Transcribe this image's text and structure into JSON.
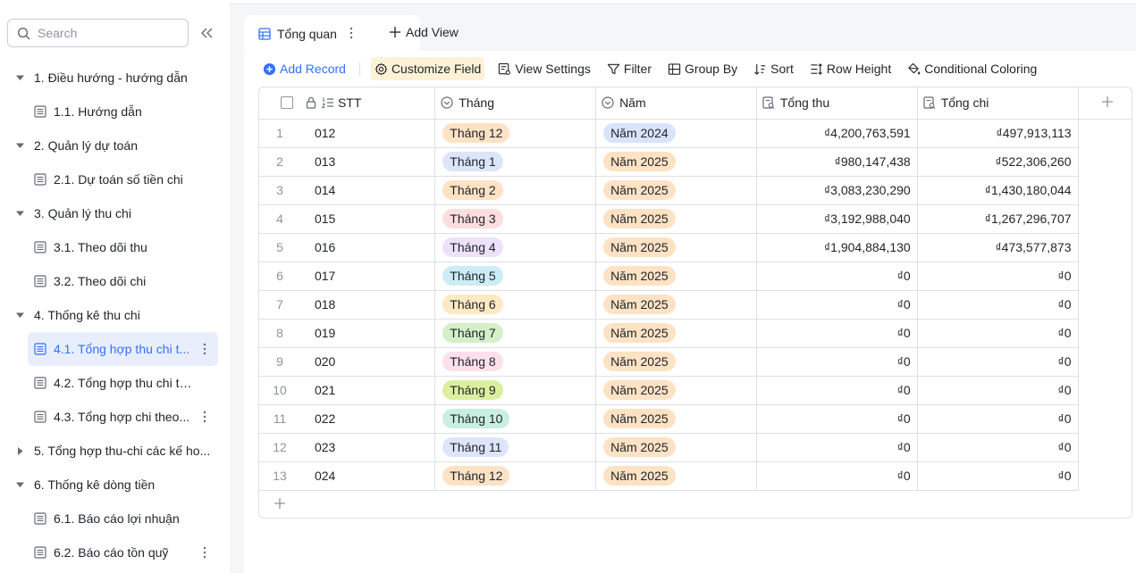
{
  "sidebar": {
    "search_placeholder": "Search",
    "items": [
      {
        "type": "group",
        "label": "1. Điều hướng - hướng dẫn",
        "expanded": true
      },
      {
        "type": "leaf",
        "label": "1.1. Hướng dẫn"
      },
      {
        "type": "group",
        "label": "2. Quản lý dự toán",
        "expanded": true
      },
      {
        "type": "leaf",
        "label": "2.1. Dự toán số tiền chi"
      },
      {
        "type": "group",
        "label": "3. Quản lý thu chi",
        "expanded": true
      },
      {
        "type": "leaf",
        "label": "3.1. Theo dõi thu"
      },
      {
        "type": "leaf",
        "label": "3.2. Theo dõi chi"
      },
      {
        "type": "group",
        "label": "4. Thống kê thu chi",
        "expanded": true
      },
      {
        "type": "leaf",
        "label": "4.1. Tổng hợp thu chi t...",
        "active": true,
        "more": true
      },
      {
        "type": "leaf",
        "label": "4.2. Tổng hợp thu chi theo..."
      },
      {
        "type": "leaf",
        "label": "4.3. Tổng hợp chi theo...",
        "more": true
      },
      {
        "type": "group",
        "label": "5. Tổng hợp thu-chi các kế ho...",
        "expanded": false
      },
      {
        "type": "group",
        "label": "6. Thống kê dòng tiền",
        "expanded": true
      },
      {
        "type": "leaf",
        "label": "6.1. Báo cáo lợi nhuận"
      },
      {
        "type": "leaf",
        "label": "6.2. Báo cáo tồn quỹ",
        "more": true
      }
    ]
  },
  "tabs": {
    "active_label": "Tổng quan",
    "add_view_label": "Add View"
  },
  "toolbar": {
    "add_record": "Add Record",
    "customize_field": "Customize Field",
    "view_settings": "View Settings",
    "filter": "Filter",
    "group_by": "Group By",
    "sort": "Sort",
    "row_height": "Row Height",
    "conditional_coloring": "Conditional Coloring"
  },
  "table": {
    "columns": [
      "STT",
      "Tháng",
      "Năm",
      "Tổng thu",
      "Tổng chi"
    ],
    "rows": [
      {
        "n": "1",
        "stt": "012",
        "thang": "Tháng 12",
        "thang_color": "#fde2c4",
        "nam": "Năm 2024",
        "nam_color": "#d9e4fb",
        "thu": "₫4,200,763,591",
        "chi": "₫497,913,113"
      },
      {
        "n": "2",
        "stt": "013",
        "thang": "Tháng 1",
        "thang_color": "#dde5fb",
        "nam": "Năm 2025",
        "nam_color": "#fde2c4",
        "thu": "₫980,147,438",
        "chi": "₫522,306,260"
      },
      {
        "n": "3",
        "stt": "014",
        "thang": "Tháng 2",
        "thang_color": "#fde2c4",
        "nam": "Năm 2025",
        "nam_color": "#fde2c4",
        "thu": "₫3,083,230,290",
        "chi": "₫1,430,180,044"
      },
      {
        "n": "4",
        "stt": "015",
        "thang": "Tháng 3",
        "thang_color": "#fddede",
        "nam": "Năm 2025",
        "nam_color": "#fde2c4",
        "thu": "₫3,192,988,040",
        "chi": "₫1,267,296,707"
      },
      {
        "n": "5",
        "stt": "016",
        "thang": "Tháng 4",
        "thang_color": "#ece2fa",
        "nam": "Năm 2025",
        "nam_color": "#fde2c4",
        "thu": "₫1,904,884,130",
        "chi": "₫473,577,873"
      },
      {
        "n": "6",
        "stt": "017",
        "thang": "Tháng 5",
        "thang_color": "#ccecf6",
        "nam": "Năm 2025",
        "nam_color": "#fde2c4",
        "thu": "₫0",
        "chi": "₫0"
      },
      {
        "n": "7",
        "stt": "018",
        "thang": "Tháng 6",
        "thang_color": "#fde9c4",
        "nam": "Năm 2025",
        "nam_color": "#fde2c4",
        "thu": "₫0",
        "chi": "₫0"
      },
      {
        "n": "8",
        "stt": "019",
        "thang": "Tháng 7",
        "thang_color": "#d3f0c8",
        "nam": "Năm 2025",
        "nam_color": "#fde2c4",
        "thu": "₫0",
        "chi": "₫0"
      },
      {
        "n": "9",
        "stt": "020",
        "thang": "Tháng 8",
        "thang_color": "#fde0ea",
        "nam": "Năm 2025",
        "nam_color": "#fde2c4",
        "thu": "₫0",
        "chi": "₫0"
      },
      {
        "n": "10",
        "stt": "021",
        "thang": "Tháng 9",
        "thang_color": "#dcef9f",
        "nam": "Năm 2025",
        "nam_color": "#fde2c4",
        "thu": "₫0",
        "chi": "₫0"
      },
      {
        "n": "11",
        "stt": "022",
        "thang": "Tháng 10",
        "thang_color": "#c9efe2",
        "nam": "Năm 2025",
        "nam_color": "#fde2c4",
        "thu": "₫0",
        "chi": "₫0"
      },
      {
        "n": "12",
        "stt": "023",
        "thang": "Tháng 11",
        "thang_color": "#dde5fb",
        "nam": "Năm 2025",
        "nam_color": "#fde2c4",
        "thu": "₫0",
        "chi": "₫0"
      },
      {
        "n": "13",
        "stt": "024",
        "thang": "Tháng 12",
        "thang_color": "#fde2c4",
        "nam": "Năm 2025",
        "nam_color": "#fde2c4",
        "thu": "₫0",
        "chi": "₫0"
      }
    ]
  },
  "colors": {
    "accent": "#3370ff",
    "active_bg": "#e8eefc",
    "highlight_bg": "#fdf2d6",
    "border": "#dee0e3"
  }
}
